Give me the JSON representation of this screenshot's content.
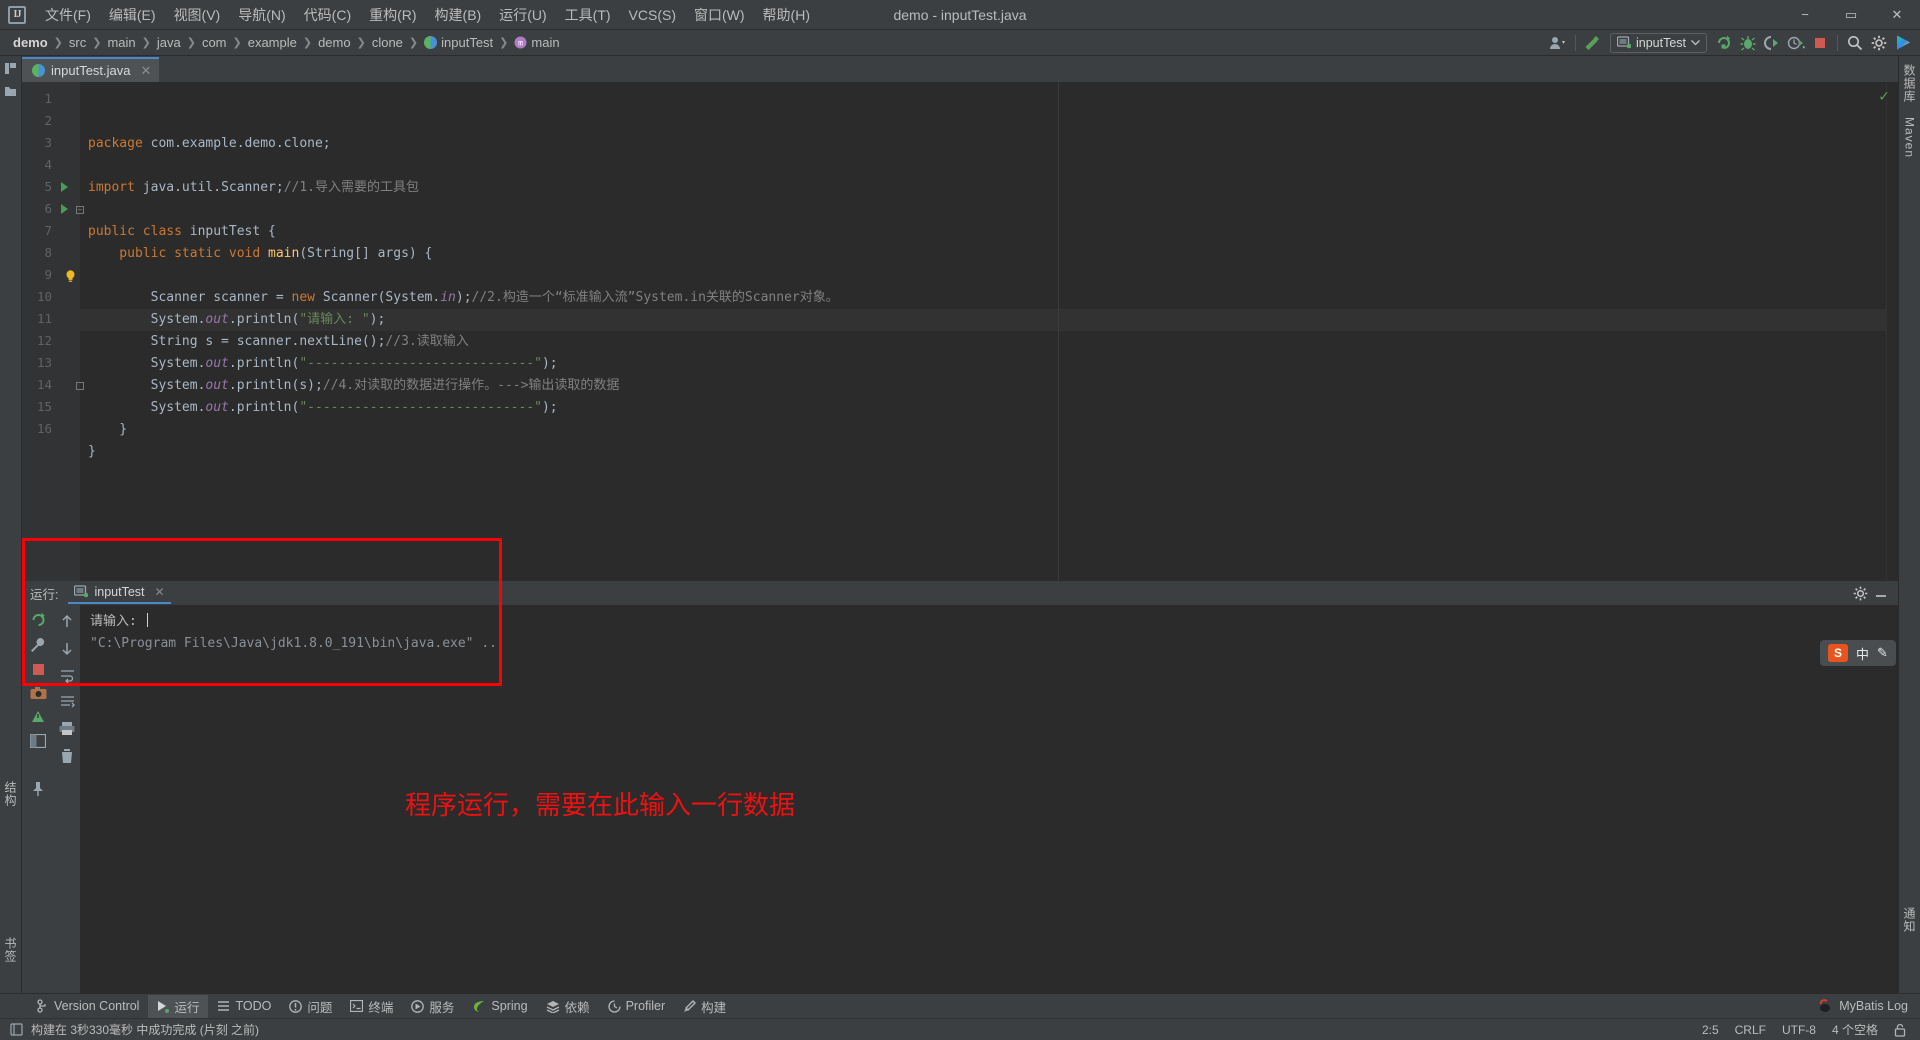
{
  "window": {
    "title": "demo - inputTest.java",
    "logo": "IJ",
    "minimize": "−",
    "maximize": "▭",
    "close": "✕"
  },
  "menu": [
    {
      "label": "文件(F)"
    },
    {
      "label": "编辑(E)"
    },
    {
      "label": "视图(V)"
    },
    {
      "label": "导航(N)"
    },
    {
      "label": "代码(C)"
    },
    {
      "label": "重构(R)"
    },
    {
      "label": "构建(B)"
    },
    {
      "label": "运行(U)"
    },
    {
      "label": "工具(T)"
    },
    {
      "label": "VCS(S)"
    },
    {
      "label": "窗口(W)"
    },
    {
      "label": "帮助(H)"
    }
  ],
  "breadcrumbs": [
    {
      "label": "demo",
      "icon": ""
    },
    {
      "label": "src",
      "icon": ""
    },
    {
      "label": "main",
      "icon": ""
    },
    {
      "label": "java",
      "icon": ""
    },
    {
      "label": "com",
      "icon": ""
    },
    {
      "label": "example",
      "icon": ""
    },
    {
      "label": "demo",
      "icon": ""
    },
    {
      "label": "clone",
      "icon": ""
    },
    {
      "label": "inputTest",
      "icon": "java-class-icon"
    },
    {
      "label": "main",
      "icon": "method-icon"
    }
  ],
  "toolbar": {
    "run_config": "inputTest",
    "icons": [
      "account-icon",
      "hammer-icon",
      "run-icon",
      "debug-icon",
      "run-coverage-icon",
      "profile-icon",
      "stop-icon",
      "search-icon",
      "settings-icon",
      "ide-icon"
    ]
  },
  "editor": {
    "tab": {
      "label": "inputTest.java",
      "close": "✕"
    },
    "line_numbers": [
      "1",
      "2",
      "3",
      "4",
      "5",
      "6",
      "7",
      "8",
      "9",
      "10",
      "11",
      "12",
      "13",
      "14",
      "15",
      "16"
    ],
    "highlighted_line": 9,
    "lines": [
      {
        "n": 1,
        "tokens": [
          {
            "t": "package ",
            "c": "kw"
          },
          {
            "t": "com.example.demo.clone;",
            "c": "cls"
          }
        ]
      },
      {
        "n": 2,
        "tokens": []
      },
      {
        "n": 3,
        "tokens": [
          {
            "t": "import ",
            "c": "kw"
          },
          {
            "t": "java.util.Scanner;",
            "c": "cls"
          },
          {
            "t": "//1.导入需要的工具包",
            "c": "cmt"
          }
        ]
      },
      {
        "n": 4,
        "tokens": []
      },
      {
        "n": 5,
        "tokens": [
          {
            "t": "public class ",
            "c": "kw"
          },
          {
            "t": "inputTest {",
            "c": "cls"
          }
        ]
      },
      {
        "n": 6,
        "tokens": [
          {
            "t": "    public static void ",
            "c": "kw"
          },
          {
            "t": "main",
            "c": "mth"
          },
          {
            "t": "(String[] args) {",
            "c": "cls"
          }
        ]
      },
      {
        "n": 7,
        "tokens": []
      },
      {
        "n": 8,
        "tokens": [
          {
            "t": "        Scanner scanner = ",
            "c": "cls"
          },
          {
            "t": "new ",
            "c": "kw"
          },
          {
            "t": "Scanner(System.",
            "c": "cls"
          },
          {
            "t": "in",
            "c": "fld"
          },
          {
            "t": ");",
            "c": "cls"
          },
          {
            "t": "//2.构造一个“标准输入流”System.in关联的Scanner对象。",
            "c": "cmt"
          }
        ]
      },
      {
        "n": 9,
        "tokens": [
          {
            "t": "        System.",
            "c": "cls"
          },
          {
            "t": "out",
            "c": "fld"
          },
          {
            "t": ".println(",
            "c": "cls"
          },
          {
            "t": "\"请输入: \"",
            "c": "str"
          },
          {
            "t": ");",
            "c": "cls"
          }
        ]
      },
      {
        "n": 10,
        "tokens": [
          {
            "t": "        String s = scanner.nextLine();",
            "c": "cls"
          },
          {
            "t": "//3.读取输入",
            "c": "cmt"
          }
        ]
      },
      {
        "n": 11,
        "tokens": [
          {
            "t": "        System.",
            "c": "cls"
          },
          {
            "t": "out",
            "c": "fld"
          },
          {
            "t": ".println(",
            "c": "cls"
          },
          {
            "t": "\"-----------------------------\"",
            "c": "str"
          },
          {
            "t": ");",
            "c": "cls"
          }
        ]
      },
      {
        "n": 12,
        "tokens": [
          {
            "t": "        System.",
            "c": "cls"
          },
          {
            "t": "out",
            "c": "fld"
          },
          {
            "t": ".println(s);",
            "c": "cls"
          },
          {
            "t": "//4.对读取的数据进行操作。--->输出读取的数据",
            "c": "cmt"
          }
        ]
      },
      {
        "n": 13,
        "tokens": [
          {
            "t": "        System.",
            "c": "cls"
          },
          {
            "t": "out",
            "c": "fld"
          },
          {
            "t": ".println(",
            "c": "cls"
          },
          {
            "t": "\"-----------------------------\"",
            "c": "str"
          },
          {
            "t": ");",
            "c": "cls"
          }
        ]
      },
      {
        "n": 14,
        "tokens": [
          {
            "t": "    }",
            "c": "cls"
          }
        ]
      },
      {
        "n": 15,
        "tokens": [
          {
            "t": "}",
            "c": "cls"
          }
        ]
      },
      {
        "n": 16,
        "tokens": []
      }
    ],
    "inspection_ok": "✓"
  },
  "run_panel": {
    "label": "运行:",
    "tab_name": "inputTest",
    "tab_close": "✕",
    "settings_icon": "gear-icon",
    "minimize_icon": "minimize-icon",
    "console_lines": [
      {
        "text": "\"C:\\Program Files\\Java\\jdk1.8.0_191\\bin\\java.exe\" ...",
        "cls": "cmdline"
      },
      {
        "text": "请输入: ",
        "cls": "input"
      }
    ],
    "toolbar_icons": [
      "rerun-icon",
      "stop-red-icon",
      "camera-icon",
      "thread-dump-icon",
      "layout-icon",
      "pin-icon",
      "scroll-up-icon",
      "scroll-down-icon",
      "soft-wrap-icon",
      "expand-icon",
      "print-icon",
      "trash-icon"
    ]
  },
  "annotation": {
    "text": "程序运行，需要在此输入一行数据",
    "color": "#ee1111"
  },
  "left_strip": {
    "project_label": "项目",
    "structure_label": "结构",
    "bookmarks_label": "书签"
  },
  "right_strip": {
    "database_label": "数据库",
    "maven_label": "Maven",
    "notif_label": "通知"
  },
  "status_tabs": [
    {
      "label": "Version Control",
      "icon": "branch-icon",
      "active": false
    },
    {
      "label": "运行",
      "icon": "run-green-icon",
      "active": true
    },
    {
      "label": "TODO",
      "icon": "todo-icon",
      "active": false
    },
    {
      "label": "问题",
      "icon": "problems-icon",
      "active": false
    },
    {
      "label": "终端",
      "icon": "terminal-icon",
      "active": false
    },
    {
      "label": "服务",
      "icon": "services-icon",
      "active": false
    },
    {
      "label": "Spring",
      "icon": "spring-icon",
      "active": false
    },
    {
      "label": "依赖",
      "icon": "dependencies-icon",
      "active": false
    },
    {
      "label": "Profiler",
      "icon": "profiler-icon",
      "active": false
    },
    {
      "label": "构建",
      "icon": "build-icon",
      "active": false
    }
  ],
  "status_tabs_right": {
    "label": "MyBatis Log",
    "icon": "mybatis-icon"
  },
  "statusbar": {
    "message": "构建在 3秒330毫秒 中成功完成 (片刻 之前)",
    "icon": "build-status-icon",
    "caret": "2:5",
    "line_sep": "CRLF",
    "encoding": "UTF-8",
    "indent": "4 个空格",
    "lock_icon": "lock-icon"
  },
  "ime": {
    "logo": "S",
    "mode": "中",
    "extra": "✎"
  }
}
